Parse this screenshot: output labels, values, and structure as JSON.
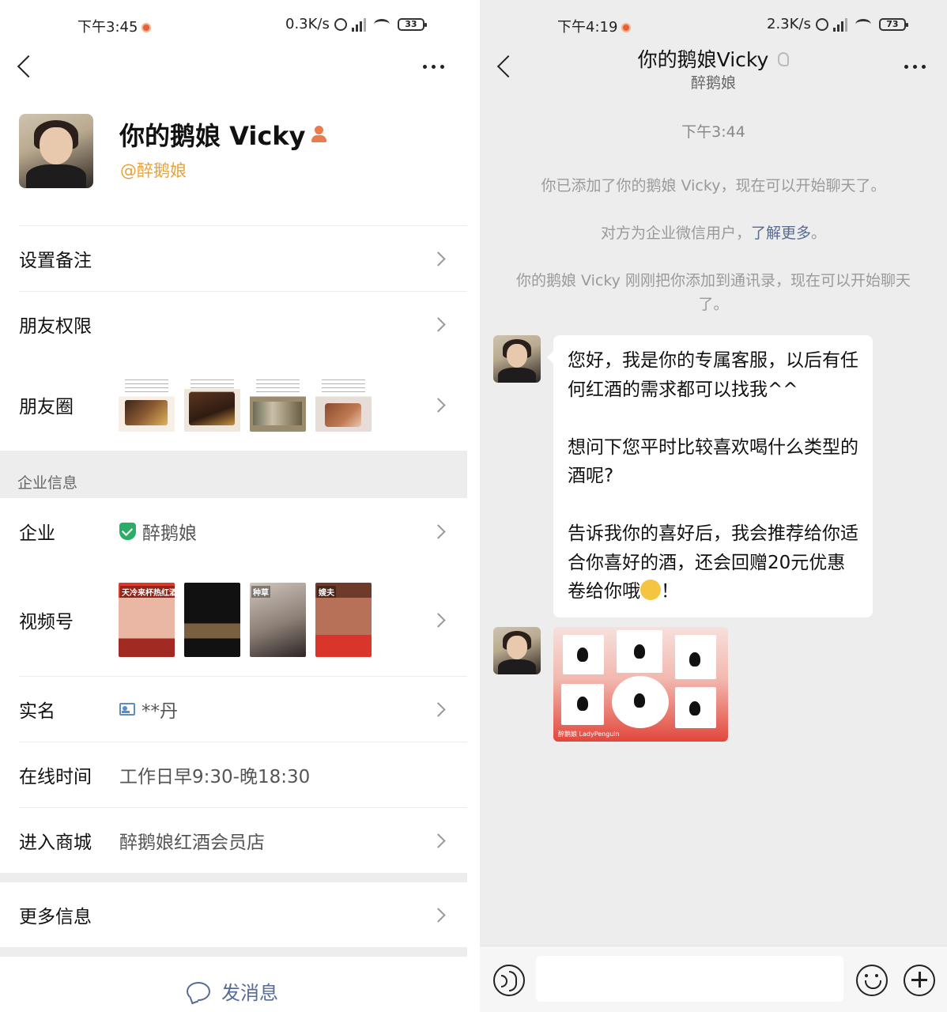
{
  "left": {
    "status": {
      "time": "下午3:45",
      "net": "0.3K/s",
      "battery": "33"
    },
    "profile": {
      "name": "你的鹅娘 Vicky",
      "corp": "@醉鹅娘"
    },
    "rows": {
      "remark": "设置备注",
      "permission": "朋友权限",
      "moments": "朋友圈",
      "section_title": "企业信息",
      "company_label": "企业",
      "company_value": "醉鹅娘",
      "channels_label": "视频号",
      "realname_label": "实名",
      "realname_value": "**丹",
      "online_label": "在线时间",
      "online_value": "工作日早9:30-晚18:30",
      "mall_label": "进入商城",
      "mall_value": "醉鹅娘红酒会员店",
      "more_label": "更多信息"
    },
    "send_message": "发消息"
  },
  "right": {
    "status": {
      "time": "下午4:19",
      "net": "2.3K/s",
      "battery": "73"
    },
    "title": "你的鹅娘Vicky",
    "subtitle": "醉鹅娘",
    "timestamp": "下午3:44",
    "system": {
      "added": "你已添加了你的鹅娘 Vicky，现在可以开始聊天了。",
      "enterprise_prefix": "对方为企业微信用户，",
      "enterprise_link": "了解更多",
      "enterprise_suffix": "。",
      "contact_added": "你的鹅娘 Vicky 刚刚把你添加到通讯录，现在可以开始聊天了。"
    },
    "message_1": "您好，我是你的专属客服，以后有任何红酒的需求都可以找我^^\n\n想问下您平时比较喜欢喝什么类型的酒呢?\n\n告诉我你的喜好后，我会推荐给你适合你喜好的酒，还会回赠20元优惠卷给你哦",
    "message_1_end": "！",
    "sticker_brand": "醉鹅娘 LadyPenguin"
  },
  "icons": {
    "back": "chevron-left-icon",
    "more": "more-dots-icon",
    "verified": "shield-check-icon",
    "id": "id-card-icon",
    "message": "chat-bubble-icon",
    "voice": "voice-icon",
    "emoji": "emoji-icon",
    "plus": "plus-icon"
  },
  "colors": {
    "accent_link": "#576b95",
    "corp_orange": "#e6a33c",
    "verified_green": "#2aae67",
    "chat_bg": "#ededed"
  }
}
